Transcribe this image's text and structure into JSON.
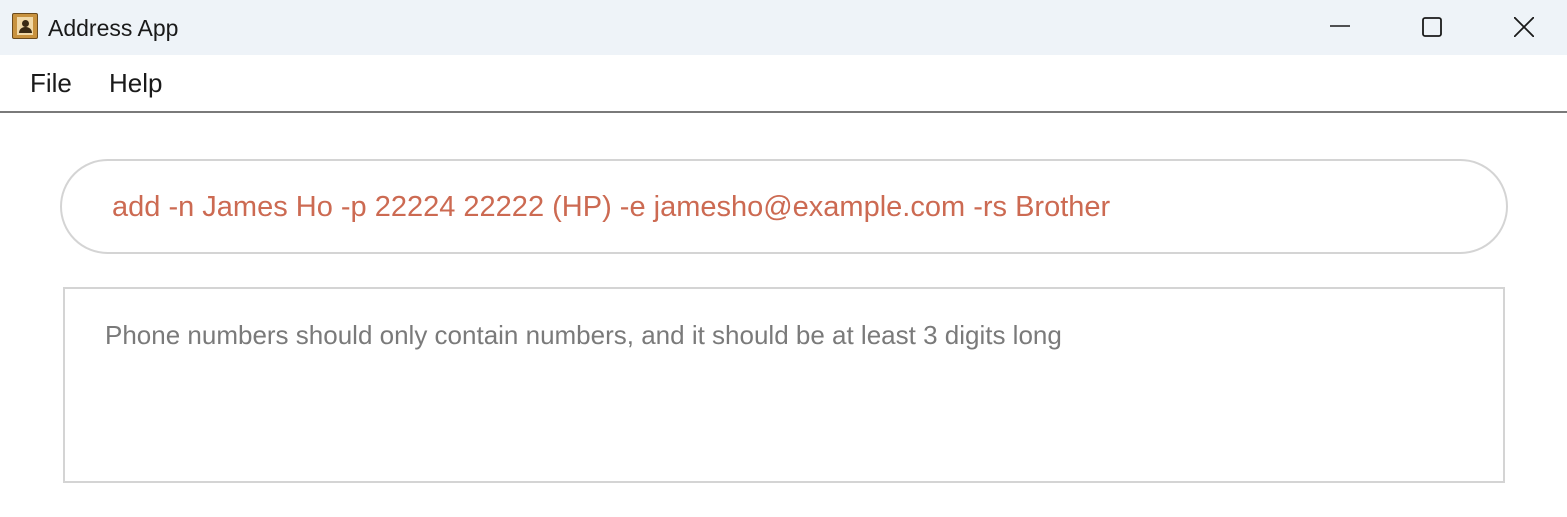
{
  "window": {
    "title": "Address App",
    "icon": "address-book-icon",
    "controls": [
      "minimize-icon",
      "maximize-icon",
      "close-icon"
    ]
  },
  "menu": {
    "items": [
      {
        "label": "File"
      },
      {
        "label": "Help"
      }
    ]
  },
  "command": {
    "value": "add -n James Ho -p 22224 22222 (HP) -e jamesho@example.com -rs Brother",
    "text_color": "#cc6a52"
  },
  "result": {
    "message": "Phone numbers should only contain numbers, and it should be at least 3 digits long",
    "text_color": "#7a7a7a"
  }
}
